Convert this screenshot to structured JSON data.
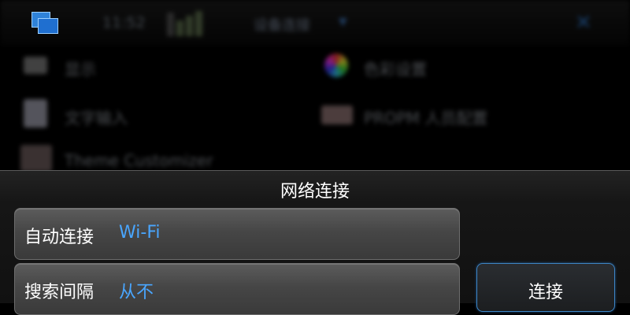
{
  "background": {
    "statusbar": {
      "clock": "11:52",
      "title": "设备连接",
      "arrow_icon": "chevron-down-icon",
      "close_icon": "close-icon",
      "switcher_icon": "task-switcher-icon"
    },
    "items": [
      {
        "label": "显示",
        "icon": "display-icon"
      },
      {
        "label": "文字输入",
        "icon": "text-input-icon"
      },
      {
        "label": "Theme Customizer",
        "icon": "theme-icon"
      },
      {
        "label": "色彩设置",
        "icon": "color-icon"
      },
      {
        "label": "PROPM 人员配置",
        "icon": "profile-icon"
      }
    ]
  },
  "dialog": {
    "title": "网络连接",
    "fields": [
      {
        "label": "自动连接",
        "value": "Wi-Fi"
      },
      {
        "label": "搜索间隔",
        "value": "从不"
      }
    ],
    "connect_label": "连接"
  },
  "colors": {
    "accent": "#49a6ff",
    "button_border": "#3d86c7",
    "field_bg": "#4a4a4a"
  }
}
